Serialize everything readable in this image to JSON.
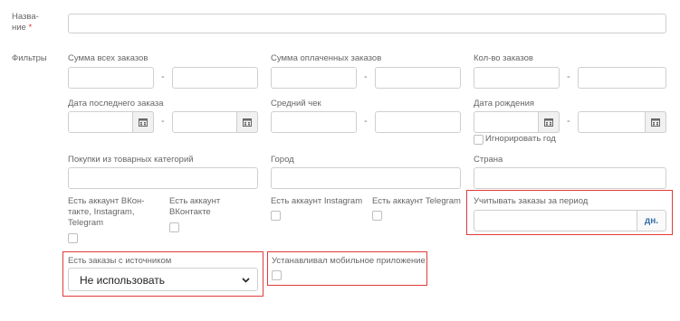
{
  "name_field": {
    "label_line1": "Назва-",
    "label_line2": "ние",
    "required_mark": "*",
    "value": ""
  },
  "filters": {
    "section_label": "Фильтры",
    "dash": "-",
    "sum_all_orders": "Сумма всех заказов",
    "sum_paid_orders": "Сумма оплаченных заказов",
    "orders_count": "Кол-во заказов",
    "last_order_date": "Дата последнего заказа",
    "avg_check": "Средний чек",
    "birth_date": "Дата рождения",
    "ignore_year": "Игнорировать год",
    "categories": "Покупки из товарных категорий",
    "city": "Город",
    "country": "Страна",
    "has_vk_insta_tg": "Есть аккаунт ВКон-такте, Instagram, Telegram",
    "has_vk": "Есть аккаунт ВКонтакте",
    "has_instagram": "Есть аккаунт Instagram",
    "has_telegram": "Есть аккаунт Telegram",
    "orders_period": "Учитывать заказы за период",
    "days_unit": "дн.",
    "orders_source": "Есть заказы с источником",
    "source_value": "Не использовать",
    "mobile_app": "Устанавливал мобильное приложение"
  },
  "icons": {
    "calendar": "calendar-icon",
    "chevron": "chevron-down-icon"
  },
  "colors": {
    "highlight": "#e03a3a",
    "addon_text": "#3a6ea8"
  }
}
